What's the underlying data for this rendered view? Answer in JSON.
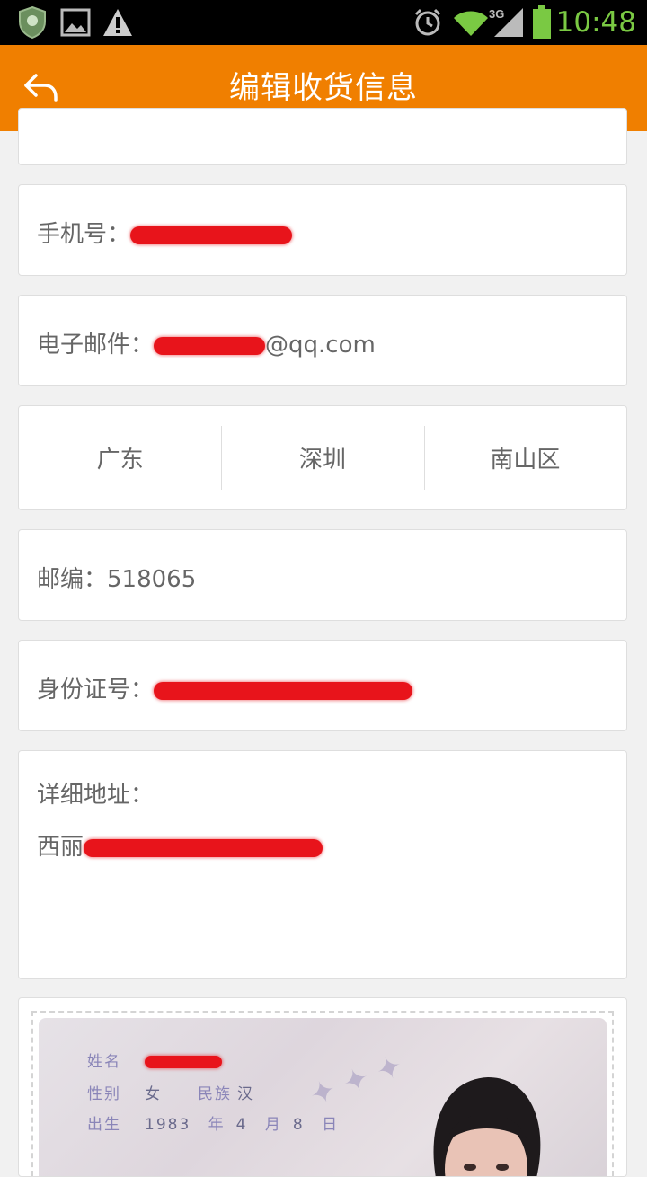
{
  "status_bar": {
    "time": "10:48",
    "network_label": "3G",
    "icons": [
      "shield-icon",
      "image-icon",
      "warning-icon",
      "alarm-icon",
      "wifi-icon",
      "signal-icon",
      "battery-icon"
    ],
    "time_color": "#7ac943"
  },
  "header": {
    "title": "编辑收货信息",
    "back_icon": "back-arrow-icon",
    "background_color": "#f07f00"
  },
  "form": {
    "phone_label": "手机号：",
    "email_label": "电子邮件：",
    "email_value_suffix": "@qq.com",
    "region": {
      "province": "广东",
      "city": "深圳",
      "district": "南山区"
    },
    "postcode_label": "邮编：",
    "postcode_value": "518065",
    "id_label": "身份证号：",
    "address_label": "详细地址：",
    "address_value_prefix": "西丽"
  },
  "id_photo": {
    "name_label": "姓名",
    "gender_label": "性别",
    "gender_value": "女",
    "ethnicity_label": "民族",
    "ethnicity_value": "汉",
    "birth_label": "出生",
    "birth_year": "1983",
    "year_unit": "年",
    "birth_month": "4",
    "month_unit": "月",
    "birth_day": "8",
    "day_unit": "日"
  }
}
